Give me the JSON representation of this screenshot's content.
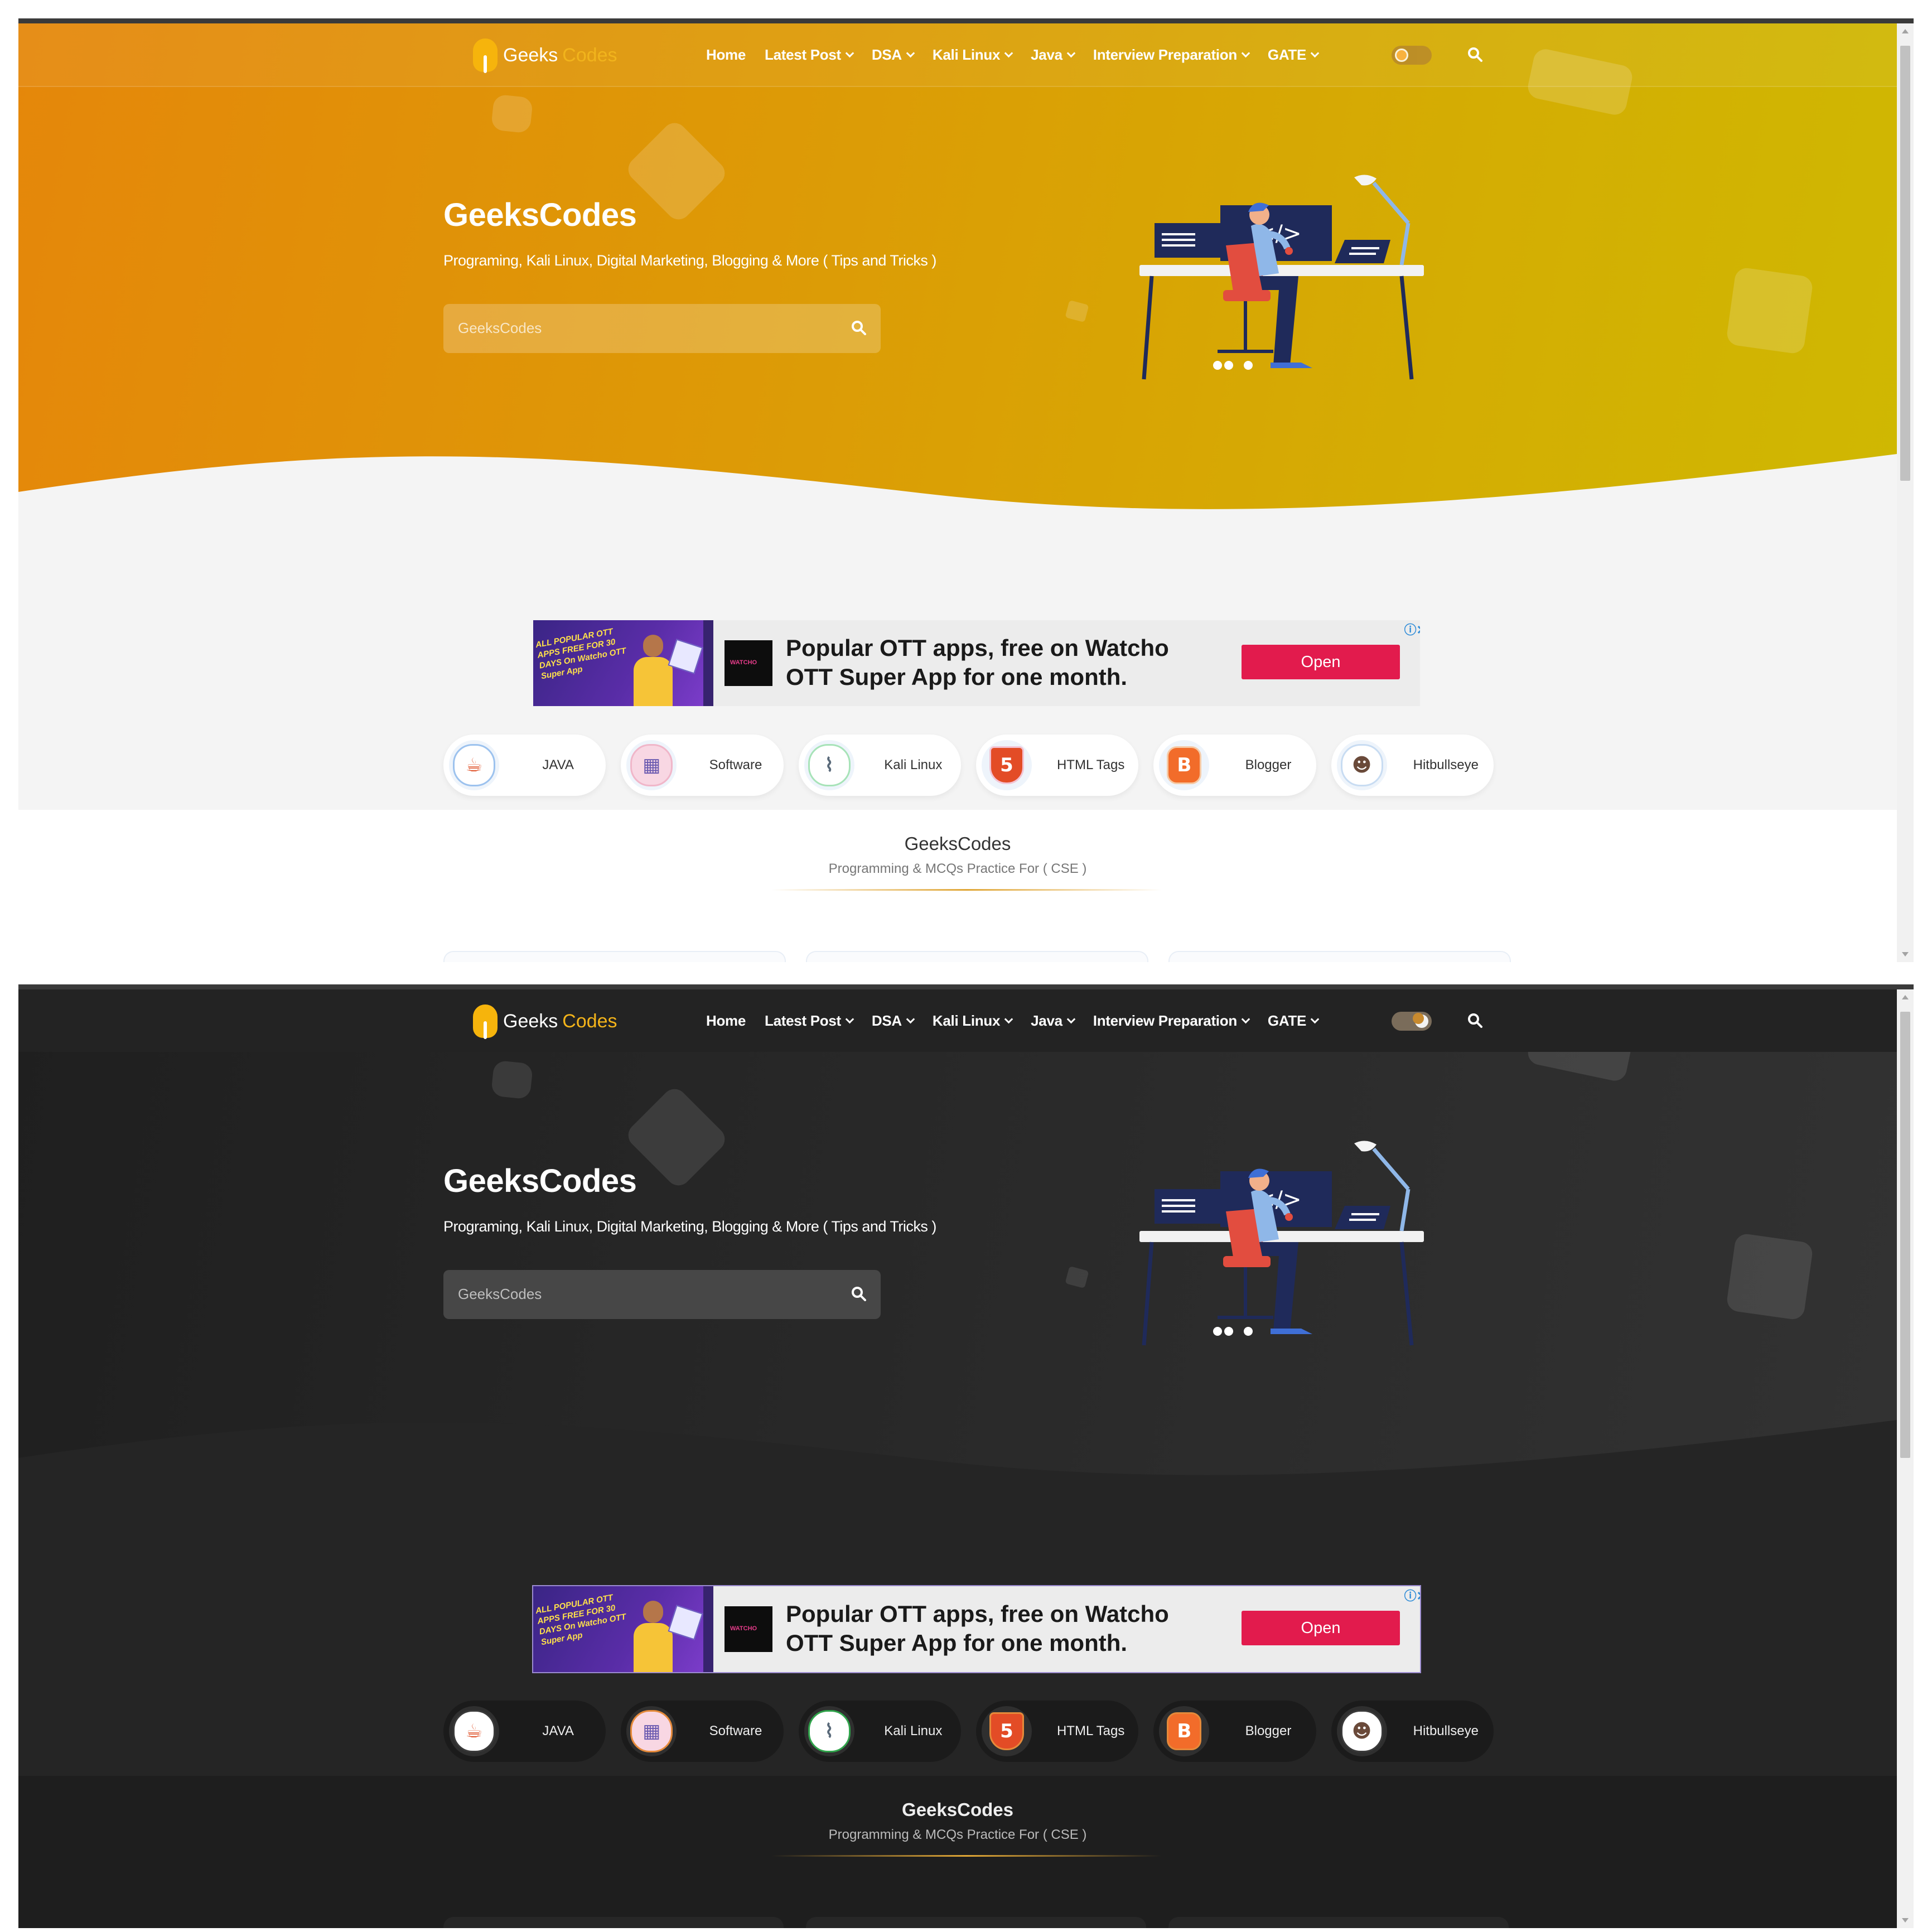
{
  "brand": {
    "part1": "Geeks",
    "part2": "Codes"
  },
  "nav": {
    "items": [
      {
        "label": "Home",
        "dropdown": false
      },
      {
        "label": "Latest Post",
        "dropdown": true
      },
      {
        "label": "DSA",
        "dropdown": true
      },
      {
        "label": "Kali Linux",
        "dropdown": true
      },
      {
        "label": "Java",
        "dropdown": true
      },
      {
        "label": "Interview Preparation",
        "dropdown": true
      },
      {
        "label": "GATE",
        "dropdown": true
      }
    ]
  },
  "hero": {
    "title": "GeeksCodes",
    "subtitle": "Programing, Kali Linux, Digital Marketing, Blogging & More ( Tips and Tricks )",
    "search_placeholder": "GeeksCodes"
  },
  "ad": {
    "banner_text": "ALL POPULAR OTT APPS FREE FOR 30 DAYS On Watcho OTT Super App",
    "brand": "WATCHO",
    "headline": "Popular OTT apps, free on Watcho OTT Super App for one month.",
    "cta": "Open",
    "info_icon": "ⓘ✕"
  },
  "categories": [
    {
      "label": "JAVA",
      "icon": "java-icon"
    },
    {
      "label": "Software",
      "icon": "software-icon"
    },
    {
      "label": "Kali Linux",
      "icon": "kali-linux-icon"
    },
    {
      "label": "HTML Tags",
      "icon": "html5-icon"
    },
    {
      "label": "Blogger",
      "icon": "blogger-icon"
    },
    {
      "label": "Hitbullseye",
      "icon": "hitbullseye-avatar-icon"
    }
  ],
  "section": {
    "title": "GeeksCodes",
    "subtitle": "Programming & MCQs Practice For ( CSE )"
  },
  "themes": {
    "light": {
      "accent": "#e0a636",
      "hero_start": "#e5870a",
      "hero_end": "#cfb802"
    },
    "dark": {
      "accent": "#e0a636",
      "hero_start": "#1f1f1f",
      "hero_end": "#323232"
    }
  }
}
